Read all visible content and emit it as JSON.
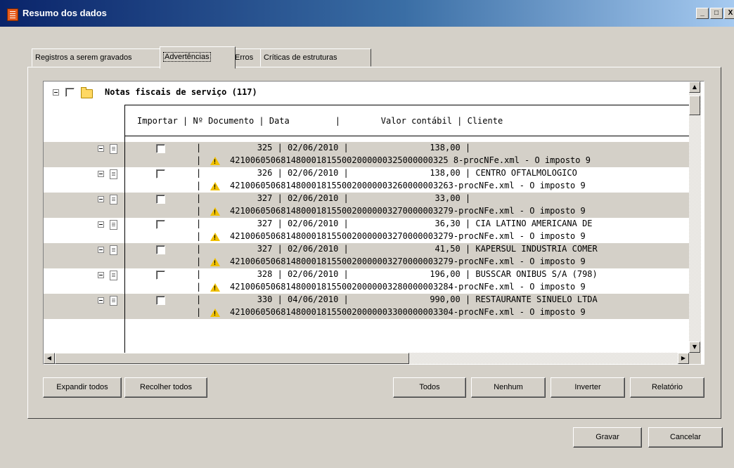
{
  "window": {
    "title": "Resumo dos dados",
    "minimize": "_",
    "maximize": "□",
    "close": "X"
  },
  "tabs": [
    {
      "label": "Registros a serem gravados"
    },
    {
      "label": "Advertências"
    },
    {
      "label": "Erros"
    },
    {
      "label": "Críticas de estruturas"
    }
  ],
  "tree": {
    "group_label": "Notas fiscais de serviço (117)",
    "header": "Importar | Nº Documento | Data         |        Valor contábil | Cliente",
    "rows": [
      {
        "line1": "|           325 | 02/06/2010 |                138,00 |",
        "line2": "4210060506814800018155002000000325000000325 8-procNFe.xml - O imposto 9"
      },
      {
        "line1": "|           326 | 02/06/2010 |                138,00 | CENTRO OFTALMOLOGICO",
        "line2": "42100605068148000181550020000003260000003263-procNFe.xml - O imposto 9"
      },
      {
        "line1": "|           327 | 02/06/2010 |                 33,00 |",
        "line2": "42100605068148000181550020000003270000003279-procNFe.xml - O imposto 9"
      },
      {
        "line1": "|           327 | 02/06/2010 |                 36,30 | CIA LATINO AMERICANA DE",
        "line2": "42100605068148000181550020000003270000003279-procNFe.xml - O imposto 9"
      },
      {
        "line1": "|           327 | 02/06/2010 |                 41,50 | KAPERSUL INDUSTRIA COMER",
        "line2": "42100605068148000181550020000003270000003279-procNFe.xml - O imposto 9"
      },
      {
        "line1": "|           328 | 02/06/2010 |                196,00 | BUSSCAR ONIBUS S/A (798)",
        "line2": "42100605068148000181550020000003280000003284-procNFe.xml - O imposto 9"
      },
      {
        "line1": "|           330 | 04/06/2010 |                990,00 | RESTAURANTE SINUELO LTDA",
        "line2": "42100605068148000181550020000003300000003304-procNFe.xml - O imposto 9"
      }
    ]
  },
  "buttons": {
    "expandir": "Expandir todos",
    "recolher": "Recolher todos",
    "todos": "Todos",
    "nenhum": "Nenhum",
    "inverter": "Inverter",
    "relatorio": "Relatório",
    "gravar": "Gravar",
    "cancelar": "Cancelar"
  },
  "icons": {
    "warning": "warning-icon",
    "folder": "folder-icon",
    "document": "document-icon"
  },
  "colors": {
    "titlebar": "#0a246a",
    "face": "#d4d0c8",
    "warning": "#f0c000"
  }
}
